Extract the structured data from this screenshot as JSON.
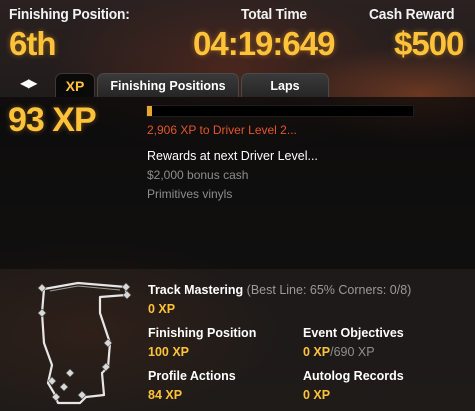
{
  "header": {
    "finishing_position_label": "Finishing Position:",
    "finishing_position_value": "6th",
    "total_time_label": "Total Time",
    "total_time_value": "04:19:649",
    "cash_reward_label": "Cash Reward",
    "cash_reward_value": "$500"
  },
  "tabs": {
    "arrows_icon": "left-right-arrows-icon",
    "items": [
      {
        "label": "XP",
        "active": true
      },
      {
        "label": "Finishing Positions",
        "active": false
      },
      {
        "label": "Laps",
        "active": false
      }
    ]
  },
  "xp_summary": {
    "earned": "93 XP",
    "progress_fraction": 0.02,
    "to_next_level": "2,906 XP to Driver Level 2...",
    "rewards_title": "Rewards at next Driver Level...",
    "rewards": [
      "$2,000 bonus cash",
      "Primitives vinyls"
    ]
  },
  "track_mastering": {
    "label": "Track Mastering",
    "detail": "(Best Line: 65% Corners: 0/8)",
    "value": "0 XP"
  },
  "stats": {
    "finishing_position": {
      "label": "Finishing Position",
      "value": "100 XP"
    },
    "event_objectives": {
      "label": "Event Objectives",
      "value": "0 XP",
      "total": "/690 XP"
    },
    "profile_actions": {
      "label": "Profile Actions",
      "value": "84 XP"
    },
    "autolog_records": {
      "label": "Autolog Records",
      "value": "0 XP"
    }
  },
  "colors": {
    "accent_yellow": "#ffc33a",
    "progress_orange": "#e2562a",
    "muted_gray": "#8d8d8d"
  }
}
